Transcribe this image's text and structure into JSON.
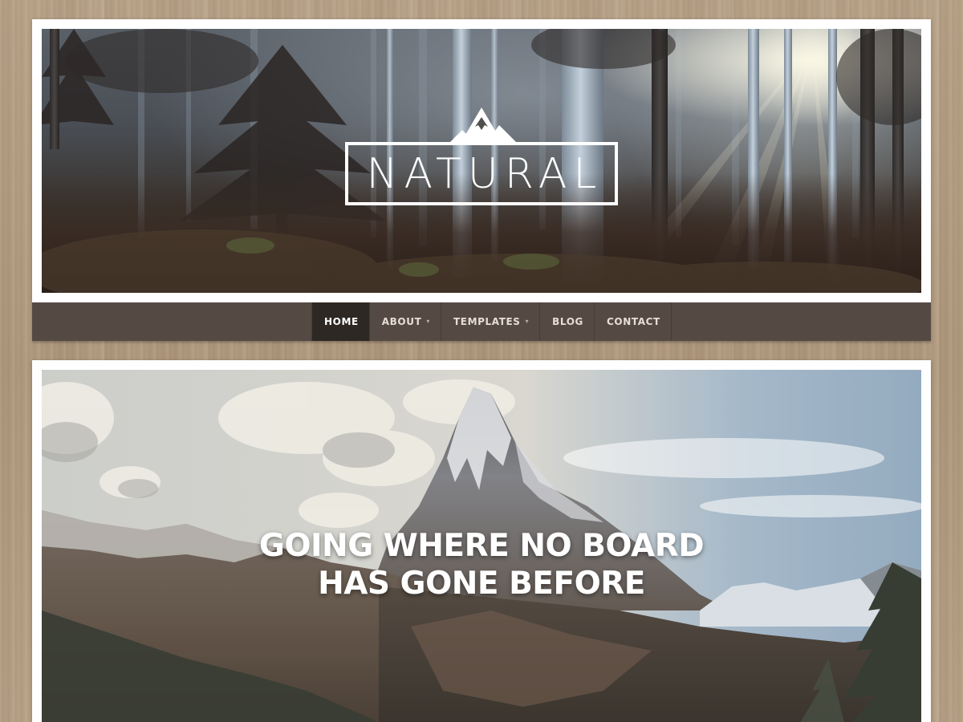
{
  "site": {
    "logo_text": "NATURAL",
    "logo_icon": "mountain-peak-icon"
  },
  "nav": {
    "items": [
      {
        "label": "HOME",
        "active": true,
        "has_dropdown": false
      },
      {
        "label": "ABOUT",
        "active": false,
        "has_dropdown": true
      },
      {
        "label": "TEMPLATES",
        "active": false,
        "has_dropdown": true
      },
      {
        "label": "BLOG",
        "active": false,
        "has_dropdown": false
      },
      {
        "label": "CONTACT",
        "active": false,
        "has_dropdown": false
      }
    ],
    "caret_glyph": "▾"
  },
  "hero": {
    "headline_line1": "GOING WHERE NO BOARD",
    "headline_line2": "HAS GONE BEFORE"
  },
  "colors": {
    "nav_background": "#554a43",
    "nav_active": "#2e2824",
    "page_background": "#b59f84",
    "card_background": "#ffffff"
  }
}
